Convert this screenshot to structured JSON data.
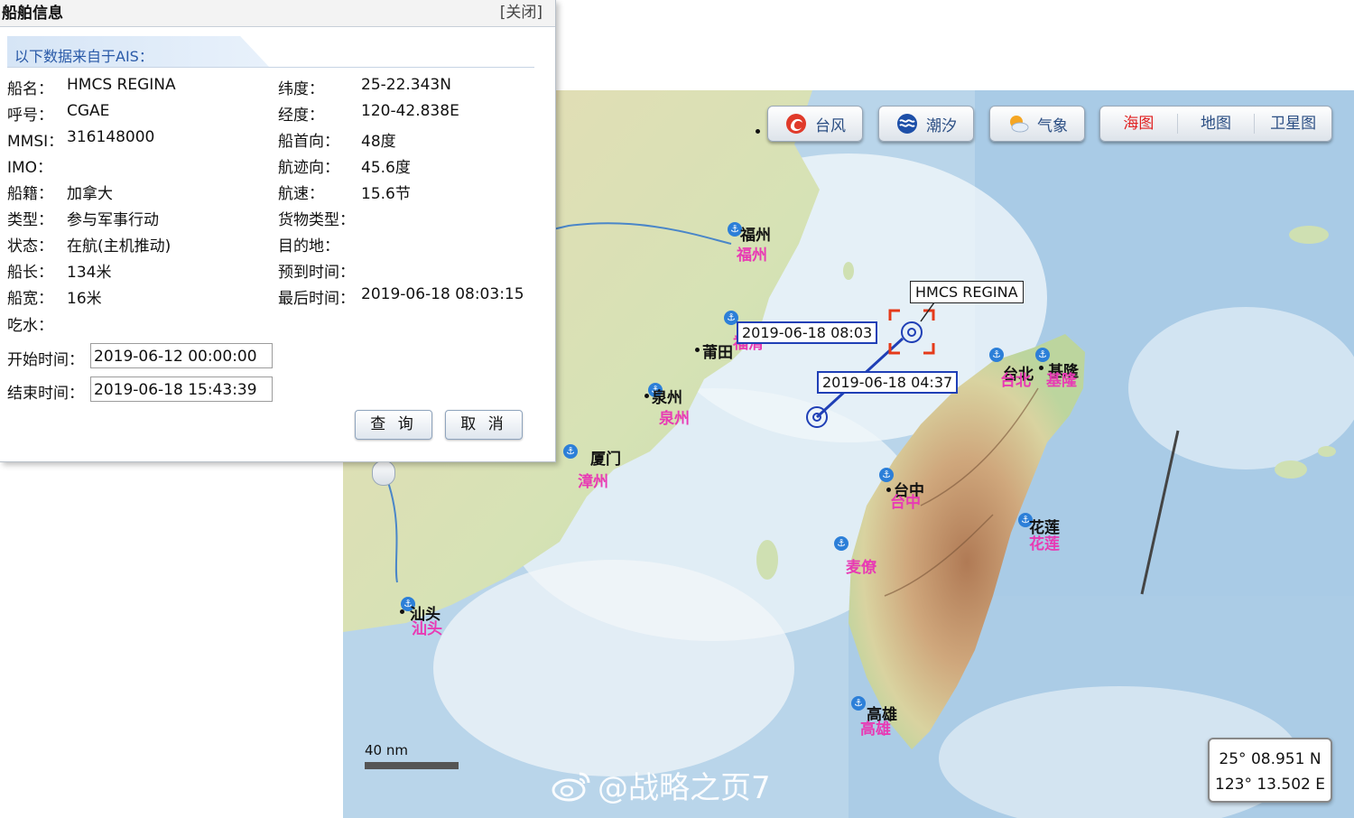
{
  "dialog": {
    "title": "船舶信息",
    "close": "[关闭]",
    "source_tab": "以下数据来自于AIS：",
    "left_fields": [
      {
        "label": "船名：",
        "value": "HMCS REGINA"
      },
      {
        "label": "呼号：",
        "value": "CGAE"
      },
      {
        "label": "MMSI：",
        "value": "316148000"
      },
      {
        "label": "IMO：",
        "value": ""
      },
      {
        "label": "船籍：",
        "value": "加拿大"
      },
      {
        "label": "类型：",
        "value": "参与军事行动"
      },
      {
        "label": "状态：",
        "value": "在航(主机推动)"
      },
      {
        "label": "船长：",
        "value": "134米"
      },
      {
        "label": "船宽：",
        "value": "16米"
      },
      {
        "label": "吃水：",
        "value": ""
      }
    ],
    "right_fields": [
      {
        "label": "纬度：",
        "value": "25-22.343N"
      },
      {
        "label": "经度：",
        "value": "120-42.838E"
      },
      {
        "label": "船首向：",
        "value": "48度"
      },
      {
        "label": "航迹向：",
        "value": "45.6度"
      },
      {
        "label": "航速：",
        "value": "15.6节"
      },
      {
        "label": "货物类型：",
        "value": ""
      },
      {
        "label": "目的地：",
        "value": ""
      },
      {
        "label": "预到时间：",
        "value": ""
      },
      {
        "label": "最后时间：",
        "value": "2019-06-18 08:03:15"
      }
    ],
    "start_label": "开始时间：",
    "start_value": "2019-06-12 00:00:00",
    "end_label": "结束时间：",
    "end_value": "2019-06-18 15:43:39",
    "query_button": "查 询",
    "cancel_button": "取 消"
  },
  "map": {
    "layers": {
      "typhoon": "台风",
      "tide": "潮汐",
      "weather": "气象"
    },
    "map_types": [
      "海图",
      "地图",
      "卫星图"
    ],
    "active_map_type": "海图",
    "cities_black": [
      "福州",
      "莆田",
      "泉州",
      "厦门",
      "汕头",
      "台北",
      "基隆",
      "台中",
      "花莲",
      "高雄"
    ],
    "ports_pink": [
      "福州",
      "福清",
      "泉州",
      "漳州",
      "汕头",
      "台北",
      "基隆",
      "台中",
      "花莲",
      "麦僚",
      "高雄"
    ],
    "track": {
      "start_time": "2019-06-18 04:37",
      "end_time": "2019-06-18 08:03",
      "ship_name": "HMCS REGINA"
    },
    "scale_label": "40 nm",
    "cursor_lat": "25° 08.951 N",
    "cursor_lon": "123° 13.502 E",
    "watermark": "@战略之页7",
    "colors": {
      "track": "#1f3fb6",
      "pink_label": "#e83ab4",
      "active_tab": "#e02020",
      "target_box": "#e53a1a"
    }
  }
}
